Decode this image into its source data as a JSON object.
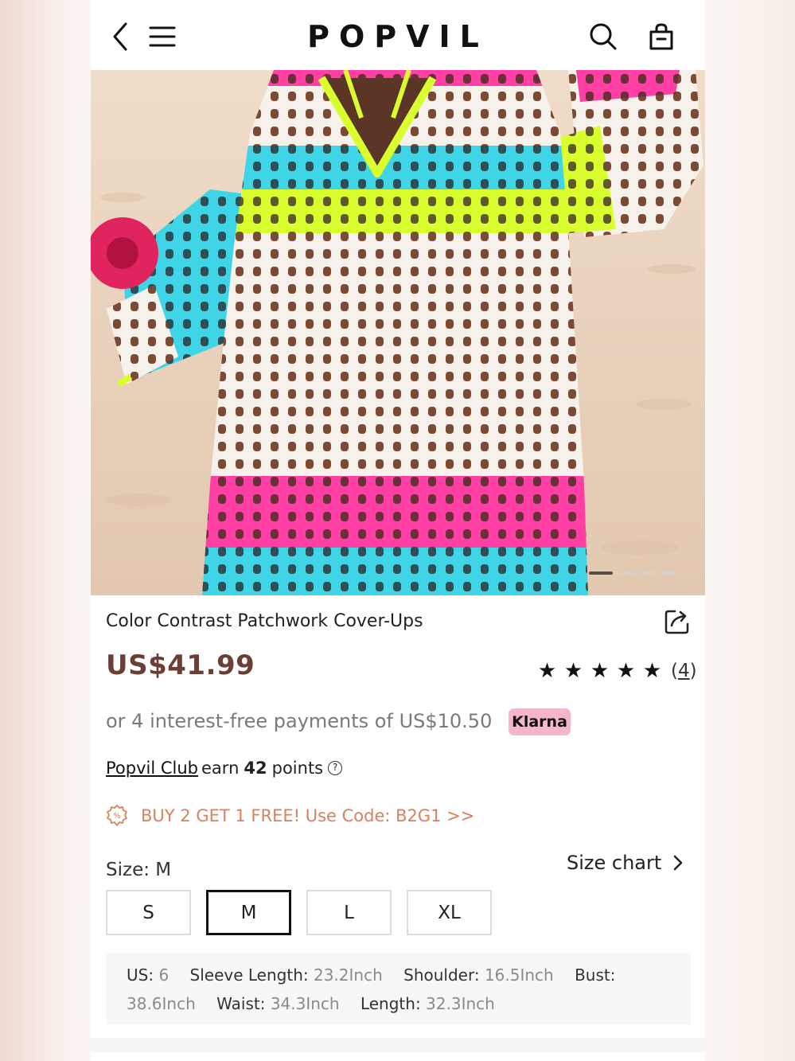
{
  "header": {
    "logo": "POPVIL",
    "icons": [
      "back-icon",
      "menu-icon",
      "search-icon",
      "bag-icon"
    ]
  },
  "gallery": {
    "total_images": 4,
    "active_index": 0
  },
  "product": {
    "title": "Color Contrast Patchwork Cover-Ups",
    "price": "US$41.99",
    "rating_stars": 5,
    "review_count": "4",
    "payments_text": "or 4 interest-free payments of US$10.50",
    "klarna_label": "Klarna",
    "club": {
      "link": "Popvil Club",
      "earn": "earn",
      "points": "42",
      "points_suffix": "points"
    },
    "promo_text": "BUY 2 GET 1 FREE! Use Code: B2G1 >>",
    "size_label": "Size: M",
    "size_chart_label": "Size chart",
    "sizes": [
      "S",
      "M",
      "L",
      "XL"
    ],
    "selected_size": "M",
    "measurements": [
      {
        "key": "US:",
        "value": "6"
      },
      {
        "key": "Sleeve Length:",
        "value": "23.2Inch"
      },
      {
        "key": "Shoulder:",
        "value": "16.5Inch"
      },
      {
        "key": "Bust:",
        "value": "38.6Inch"
      },
      {
        "key": "Waist:",
        "value": "34.3Inch"
      },
      {
        "key": "Length:",
        "value": "32.3Inch"
      }
    ]
  },
  "colors": {
    "price": "#6b3f36",
    "promo": "#d9805f",
    "klarna_bg": "#f5b5cc",
    "stripe_pink": "#ff3fa4",
    "stripe_lime": "#d9ff2e",
    "stripe_aqua": "#3fd4e6",
    "crochet_white": "#f6f1ea",
    "sand": "#e8d3bf"
  }
}
